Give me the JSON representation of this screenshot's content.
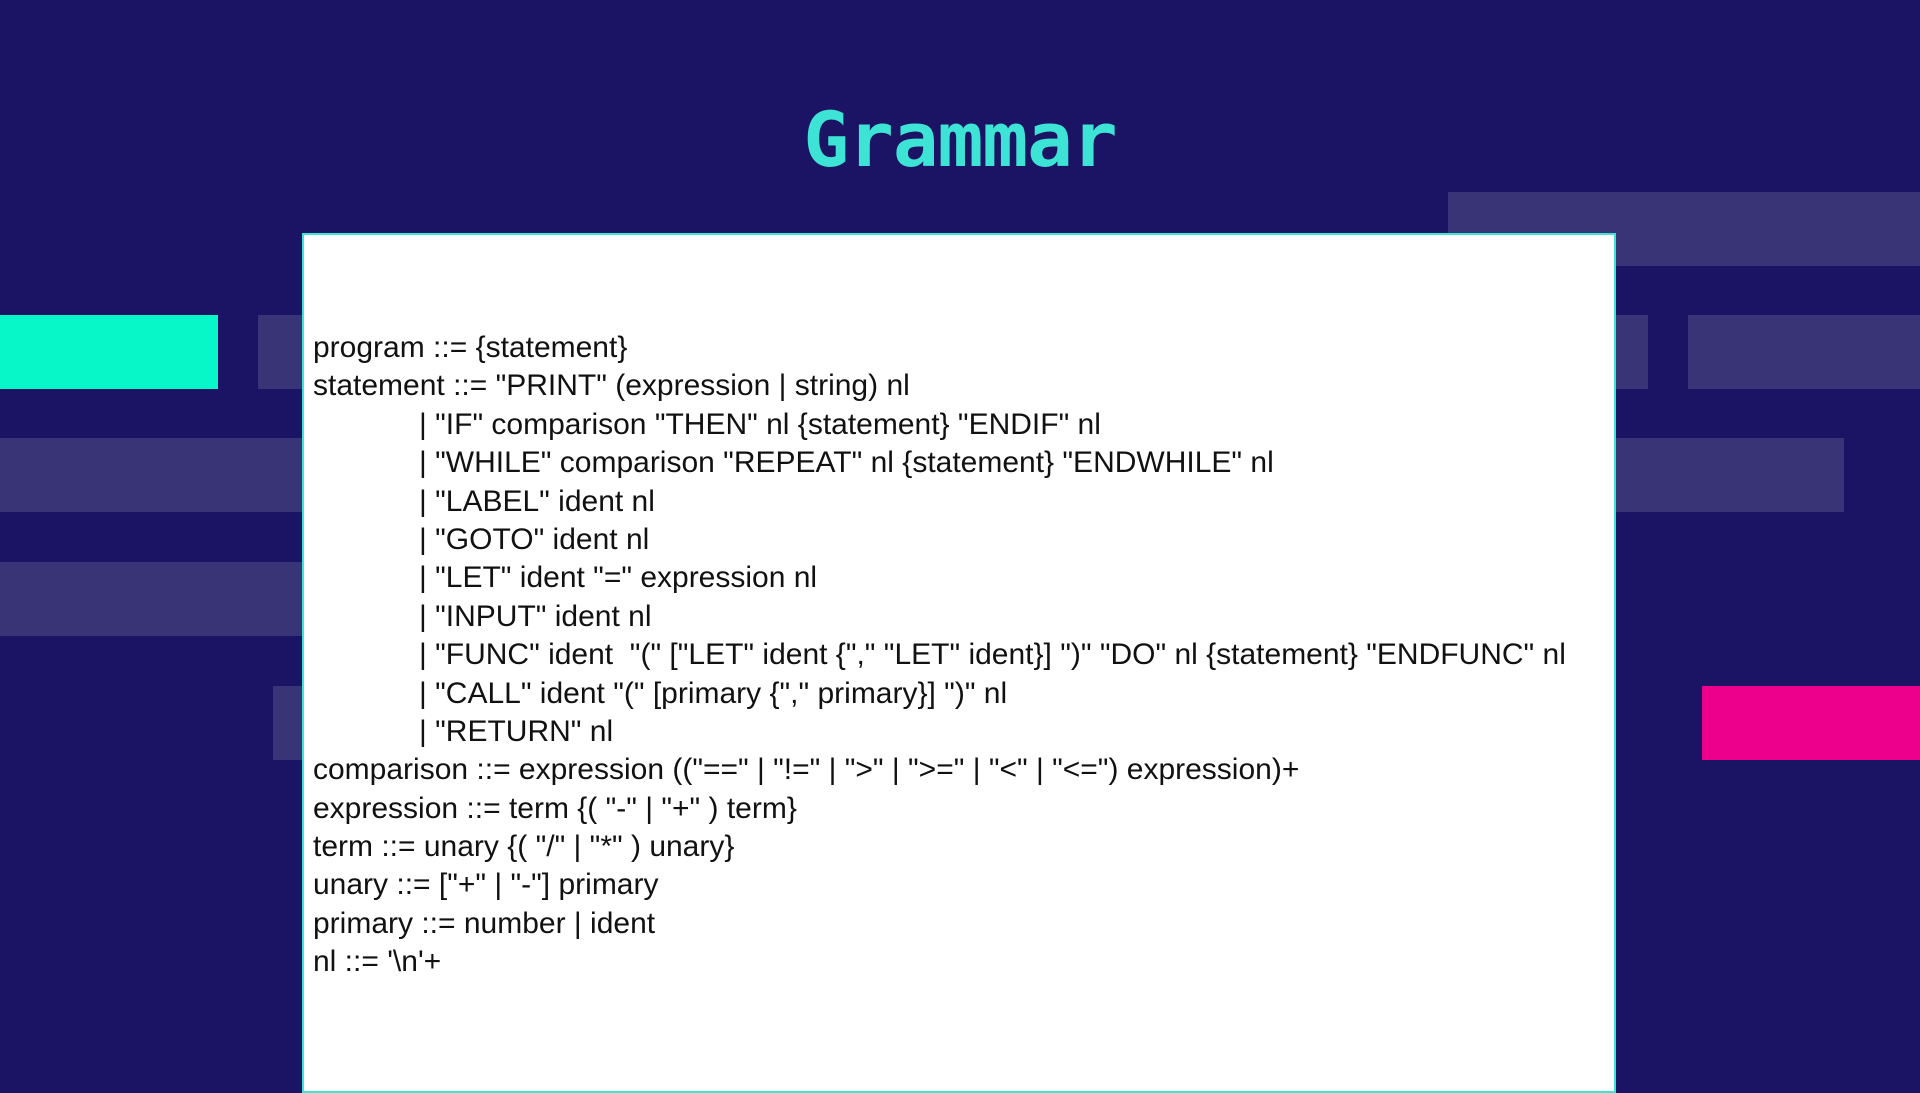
{
  "slide": {
    "title": "Grammar",
    "colors": {
      "background": "#1b1464",
      "title": "#3de3d4",
      "panel": "#ffffff",
      "panel_border": "#3de3d4",
      "accent_teal": "#08f7c9",
      "accent_pink": "#ec008c",
      "decor_bars": "#393476"
    }
  },
  "grammar": {
    "lines": [
      "program ::= {statement}",
      "statement ::= \"PRINT\" (expression | string) nl",
      "| \"IF\" comparison \"THEN\" nl {statement} \"ENDIF\" nl",
      "| \"WHILE\" comparison \"REPEAT\" nl {statement} \"ENDWHILE\" nl",
      "| \"LABEL\" ident nl",
      "| \"GOTO\" ident nl",
      "| \"LET\" ident \"=\" expression nl",
      "| \"INPUT\" ident nl",
      "| \"FUNC\" ident  \"(\" [\"LET\" ident {\",\" \"LET\" ident}] \")\" \"DO\" nl {statement} \"ENDFUNC\" nl",
      "| \"CALL\" ident \"(\" [primary {\",\" primary}] \")\" nl",
      "| \"RETURN\" nl",
      "comparison ::= expression ((\"==\" | \"!=\" | \">\" | \">=\" | \"<\" | \"<=\") expression)+",
      "expression ::= term {( \"-\" | \"+\" ) term}",
      "term ::= unary {( \"/\" | \"*\" ) unary}",
      "unary ::= [\"+\" | \"-\"] primary",
      "primary ::= number | ident",
      "nl ::= '\\n'+"
    ]
  }
}
